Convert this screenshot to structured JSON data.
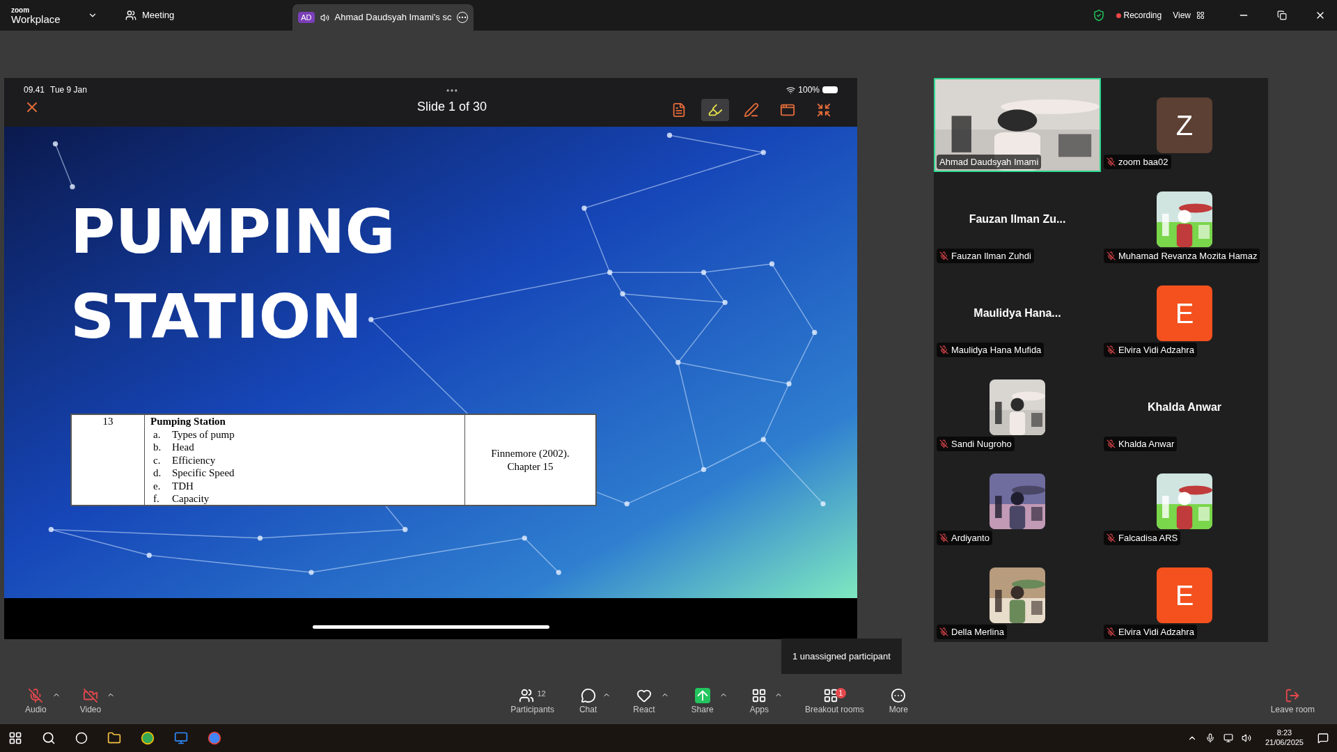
{
  "app": {
    "logo_top": "zoom",
    "logo_bottom": "Workplace",
    "meeting_label": "Meeting",
    "share_tab": {
      "initials": "AD",
      "label": "Ahmad Daudsyah Imami's sc"
    },
    "recording": "Recording",
    "view": "View"
  },
  "slide_header": {
    "time": "09.41",
    "date": "Tue 9 Jan",
    "title": "Slide 1 of 30",
    "battery": "100%",
    "tools": [
      {
        "kind": "notes",
        "selected": false
      },
      {
        "kind": "highlighter",
        "selected": true
      },
      {
        "kind": "pen",
        "selected": false
      },
      {
        "kind": "window",
        "selected": false
      },
      {
        "kind": "shrink",
        "selected": false
      }
    ]
  },
  "slide": {
    "title_lines": [
      "PUMPING",
      "STATION"
    ],
    "table": {
      "number": "13",
      "topic": "Pumping Station",
      "items": [
        {
          "letter": "a.",
          "text": "Types of pump"
        },
        {
          "letter": "b.",
          "text": "Head"
        },
        {
          "letter": "c.",
          "text": "Efficiency"
        },
        {
          "letter": "d.",
          "text": "Specific Speed"
        },
        {
          "letter": "e.",
          "text": "TDH"
        },
        {
          "letter": "f.",
          "text": "Capacity"
        }
      ],
      "reference_lines": [
        "Finnemore (2002).",
        "Chapter 15"
      ]
    }
  },
  "participants": [
    {
      "kind": "video",
      "name": "Ahmad Daudsyah Imami",
      "muted": false,
      "selected": true
    },
    {
      "kind": "letter",
      "letter": "Z",
      "color": "#5c4033",
      "name": "zoom baa02",
      "muted": true,
      "selected": false
    },
    {
      "kind": "name",
      "display": "Fauzan Ilman Zu...",
      "name": "Fauzan Ilman Zuhdi",
      "muted": true,
      "selected": false
    },
    {
      "name": "Muhamad Revanza Mozita Hamaz",
      "muted": true,
      "selected": false
    },
    {
      "kind": "name",
      "display": "Maulidya Hana...",
      "name": "Maulidya Hana Mufida",
      "muted": true,
      "selected": false
    },
    {
      "kind": "letter",
      "letter": "E",
      "color": "#f4511e",
      "name": "Elvira Vidi Adzahra",
      "muted": true,
      "selected": false
    },
    {
      "name": "Sandi Nugroho",
      "muted": true,
      "selected": false
    },
    {
      "kind": "name",
      "display": "Khalda Anwar",
      "name": "Khalda Anwar",
      "muted": true,
      "selected": false
    },
    {
      "name": "Ardiyanto",
      "muted": true,
      "selected": false
    },
    {
      "name": "Falcadisa ARS",
      "muted": true,
      "selected": false
    },
    {
      "name": "Della Merlina",
      "muted": true,
      "selected": false
    },
    {
      "kind": "letter",
      "letter": "E",
      "color": "#f4511e",
      "name": "Elvira Vidi Adzahra",
      "muted": true,
      "selected": false
    }
  ],
  "tooltip": "1 unassigned participant",
  "toolbar": {
    "left": [
      {
        "kind": "audio",
        "label": "Audio",
        "caret": true
      },
      {
        "kind": "video",
        "label": "Video",
        "caret": true
      }
    ],
    "center": [
      {
        "kind": "participants",
        "label": "Participants",
        "count": "12",
        "caret": false
      },
      {
        "kind": "chat",
        "label": "Chat",
        "caret": true
      },
      {
        "kind": "react",
        "label": "React",
        "caret": true
      },
      {
        "kind": "share",
        "label": "Share",
        "caret": true
      },
      {
        "kind": "apps",
        "label": "Apps",
        "caret": true
      },
      {
        "kind": "breakout",
        "label": "Breakout rooms",
        "badge": "1",
        "caret": false
      },
      {
        "kind": "more",
        "label": "More",
        "caret": false
      }
    ],
    "leave": "Leave room"
  },
  "taskbar": {
    "time": "8:23",
    "date": "21/06/2025"
  }
}
